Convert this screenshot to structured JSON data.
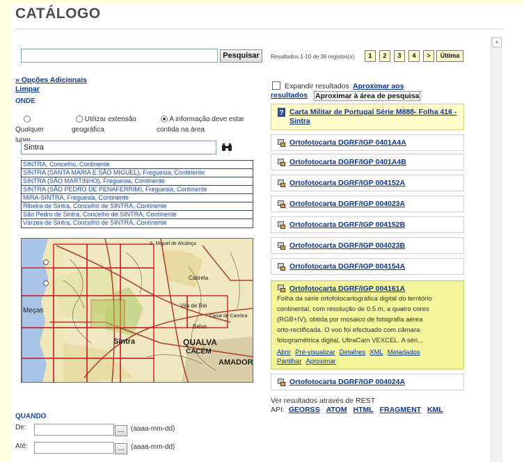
{
  "title": "CATÁLOGO",
  "search": {
    "value": "",
    "button": "Pesquisar"
  },
  "results_info": "Resultados 1-10 de 36 registos(s)",
  "pagination": {
    "pages": [
      "1",
      "2",
      "3",
      "4"
    ],
    "next": ">",
    "last": "Última"
  },
  "options": {
    "more": "» Opções Adicionais",
    "clear": "Limpar"
  },
  "where": {
    "label": "ONDE",
    "radios": [
      {
        "label": "Qualquer lugar",
        "checked": false
      },
      {
        "label": "Utilizar extensão geográfica",
        "checked": false
      },
      {
        "label": "A informação deve estar contida na área",
        "checked": true
      }
    ],
    "place_value": "Sintra",
    "suggestions": [
      "SINTRA, Concelho, Continente",
      "SINTRA (SANTA MARIA E SÃO MIGUEL), Freguesia, Continente",
      "SINTRA (SÃO MARTINHO), Freguesia, Continente",
      "SINTRA (SÃO PEDRO DE PENAFERRIM), Freguesia, Continente",
      "MIRA-SINTRA, Freguesia, Continente",
      "Ribeira de Sintra, Concelho de SINTRA, Continente",
      "São Pedro de Sintra, Concelho de SINTRA, Continente",
      "Várzea de Sintra, Concelho de SINTRA, Continente"
    ]
  },
  "map_labels": {
    "l1": "Sintra",
    "l2": "QUALVA",
    "l3": "CACÉM",
    "l4": "AMADORA",
    "l5": "Meças",
    "l6": "S. Miguel de Alcainça",
    "l7": "Cabrela",
    "l8": "Vila de Rei",
    "l9": "Casal de Cambra",
    "l10": "Belas"
  },
  "when": {
    "label": "QUANDO",
    "from_label": "De:",
    "to_label": "Até:",
    "hint": "(aaaa-mm-dd)",
    "pick": "..."
  },
  "results_opts": {
    "expand": "Expandir resultados",
    "zoom_results_1": "Aproximar aos",
    "zoom_results_2": "resultados",
    "zoom_area": "Aproximar à área de pesquisa"
  },
  "results": [
    {
      "title_1": "Carta Militar de Portugal Série M888- Folha 416 -",
      "title_2": "Sintra",
      "icon": "help-icon"
    },
    {
      "title": "Ortofotocarta DGRF/IGP 0401A4A",
      "icon": "map-layer-icon"
    },
    {
      "title": "Ortofotocarta DGRF/IGP 0401A4B",
      "icon": "map-layer-icon"
    },
    {
      "title": "Ortofotocarta DGRF/IGP 004152A",
      "icon": "map-layer-icon"
    },
    {
      "title": "Ortofotocarta DGRF/IGP 004023A",
      "icon": "map-layer-icon"
    },
    {
      "title": "Ortofotocarta DGRF/IGP 004152B",
      "icon": "map-layer-icon"
    },
    {
      "title": "Ortofotocarta DGRF/IGP 004023B",
      "icon": "map-layer-icon"
    },
    {
      "title": "Ortofotocarta DGRF/IGP 004154A",
      "icon": "map-layer-icon"
    },
    {
      "title": "Ortofotocarta DGRF/IGP 004161A",
      "icon": "map-layer-icon",
      "desc_lines": [
        "Folha da série ortofotocartográfica digital do território",
        "continental, com resolução de 0.5 m, a quatro cores",
        "(RGB+IV), obtida por mosaico de fotografia aérea",
        "orto-rectificada. O voo foi efectuado com câmara",
        "fotogramétrica digital, UltraCam VEXCEL. A séri..."
      ],
      "actions_1": [
        "Abrir",
        "Pré-visualizar",
        "Detalhes",
        "XML",
        "Metadados"
      ],
      "actions_2": [
        "Partilhar",
        "Aproximar"
      ]
    },
    {
      "title": "Ortofotocarta DGRF/IGP 004024A",
      "icon": "map-layer-icon"
    }
  ],
  "rest": {
    "line": "Ver resultados através de REST",
    "api": "API:",
    "links": [
      "GEORSS",
      "ATOM",
      "HTML",
      "FRAGMENT",
      "KML"
    ]
  },
  "colors": {
    "accent": "#0a35a8",
    "highlight": "#f2f59a",
    "result_yellow": "#fffbc8"
  }
}
